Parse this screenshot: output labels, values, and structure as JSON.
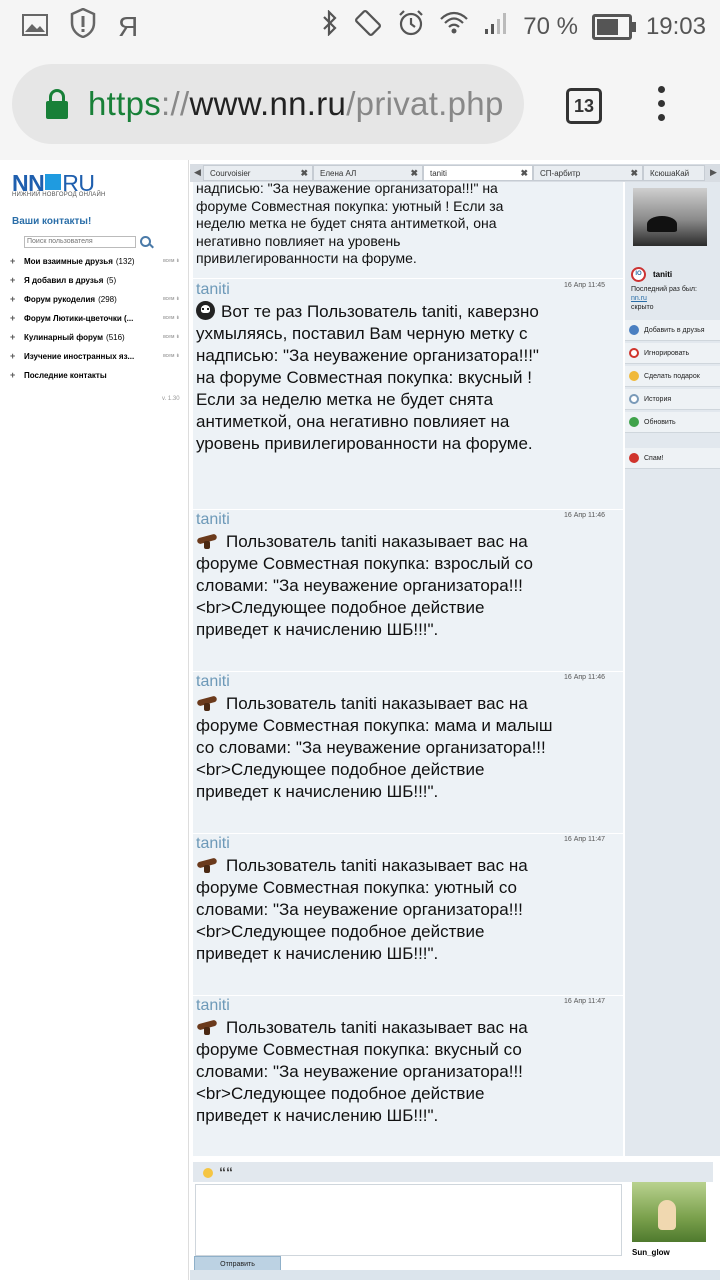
{
  "status_bar": {
    "left_icons": [
      "gallery-icon",
      "shield-alert-icon",
      "yandex-icon"
    ],
    "yandex_glyph": "Я",
    "battery_percent": "70 %",
    "time": "19:03"
  },
  "browser": {
    "url_scheme": "https",
    "url_sep": "://",
    "url_host": "www.nn.ru",
    "url_path": "/privat.php",
    "tab_count": "13"
  },
  "left_panel": {
    "logo_nn": "NN",
    "logo_ru": "RU",
    "logo_sub": "НИЖНИЙ НОВГОРОД ОНЛАЙН",
    "contacts_title": "Ваши контакты!",
    "search_placeholder": "Поиск пользователя",
    "groups": [
      {
        "label": "Мои взаимные друзья",
        "count": "(132)",
        "ctrl": "всем"
      },
      {
        "label": "Я добавил в друзья",
        "count": "(5)",
        "ctrl": ""
      },
      {
        "label": "Форум рукоделия",
        "count": "(298)",
        "ctrl": "всем"
      },
      {
        "label": "Форум Лютики-цветочки (...",
        "count": "",
        "ctrl": "всем"
      },
      {
        "label": "Кулинарный форум",
        "count": "(516)",
        "ctrl": "всем"
      },
      {
        "label": "Изучение иностранных яз...",
        "count": "",
        "ctrl": "всем"
      },
      {
        "label": "Последние контакты",
        "count": "",
        "ctrl": ""
      }
    ],
    "version": "v. 1.30"
  },
  "tabs": [
    {
      "label": "Courvoisier",
      "active": false
    },
    {
      "label": "Елена АЛ",
      "active": false
    },
    {
      "label": "taniti",
      "active": true
    },
    {
      "label": "СП-арбитр",
      "active": false
    },
    {
      "label": "КсюшаКай",
      "active": false
    }
  ],
  "messages": [
    {
      "who": "",
      "time": "",
      "icon": "",
      "text": "надписью: \"За неуважение организатора!!!\" на форуме Совместная покупка: уютный ! Если за неделю метка не будет снята антиметкой, она негативно повлияет на уровень привилегированности на форуме."
    },
    {
      "who": "taniti",
      "time": "16 Апр 11:45",
      "icon": "skull-icon",
      "text": "Вот те раз Пользователь taniti, каверзно ухмыляясь, поставил Вам черную метку с надписью: \"За неуважение организатора!!!\" на форуме Совместная покупка: вкусный ! Если за неделю метка не будет снята антиметкой, она негативно повлияет на уровень привилегированности на форуме."
    },
    {
      "who": "taniti",
      "time": "16 Апр 11:46",
      "icon": "belt-icon",
      "text": "Пользователь taniti наказывает вас на форуме Совместная покупка: взрослый со словами: \"За неуважение организатора!!!<br>Следующее подобное действие приведет к начислению ШБ!!!\"."
    },
    {
      "who": "taniti",
      "time": "16 Апр 11:46",
      "icon": "belt-icon",
      "text": "Пользователь taniti наказывает вас на форуме Совместная покупка: мама и малыш со словами: \"За неуважение организатора!!!<br>Следующее подобное действие приведет к начислению ШБ!!!\"."
    },
    {
      "who": "taniti",
      "time": "16 Апр 11:47",
      "icon": "belt-icon",
      "text": "Пользователь taniti наказывает вас на форуме Совместная покупка: уютный со словами: \"За неуважение организатора!!!<br>Следующее подобное действие приведет к начислению ШБ!!!\"."
    },
    {
      "who": "taniti",
      "time": "16 Апр 11:47",
      "icon": "belt-icon",
      "text": "Пользователь taniti наказывает вас на форуме Совместная покупка: вкусный со словами: \"За неуважение организатора!!!<br>Следующее подобное действие приведет к начислению ШБ!!!\"."
    }
  ],
  "profile": {
    "name": "taniti",
    "status_glyph": "IO",
    "last_seen_label": "Последний раз был:",
    "last_seen_site": "nn.ru",
    "last_seen_value": "скрыто"
  },
  "actions": [
    {
      "label": "Добавить в друзья",
      "icon": "add-friend-icon",
      "color": "#4a7fc1"
    },
    {
      "label": "Игнорировать",
      "icon": "ignore-icon",
      "color": "#d0342c"
    },
    {
      "label": "Сделать подарок",
      "icon": "gift-icon",
      "color": "#f0b93a"
    },
    {
      "label": "История",
      "icon": "history-icon",
      "color": "#7a9ab8"
    },
    {
      "label": "Обновить",
      "icon": "refresh-icon",
      "color": "#3fa24a"
    },
    {
      "label": "Спам!",
      "icon": "spam-icon",
      "color": "#d0342c"
    }
  ],
  "compose": {
    "quote_glyph": "““",
    "send_label": "Отправить",
    "peer_name": "Sun_glow"
  }
}
